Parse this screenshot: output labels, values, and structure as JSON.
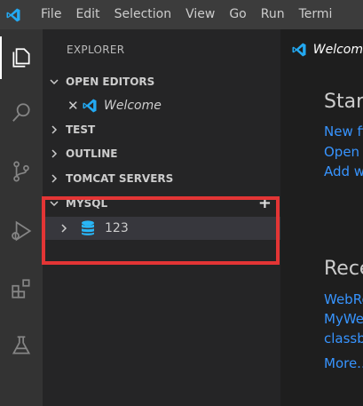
{
  "menubar": {
    "items": [
      "File",
      "Edit",
      "Selection",
      "View",
      "Go",
      "Run",
      "Termi"
    ]
  },
  "sidebar": {
    "title": "EXPLORER",
    "sections": {
      "open_editors": "OPEN EDITORS",
      "test": "TEST",
      "outline": "OUTLINE",
      "tomcat": "TOMCAT SERVERS",
      "mysql": "MYSQL"
    },
    "open_editor_label": "Welcome",
    "mysql_add": "+",
    "mysql_connection": "123"
  },
  "editor": {
    "tab_label": "Welcom",
    "start_heading": "Start",
    "start_links": [
      "New fi",
      "Open",
      "Add w"
    ],
    "recent_heading": "Rece",
    "recent_links": [
      "WebRe",
      "MyWe",
      "classb"
    ],
    "more_link": "More..."
  },
  "colors": {
    "accent": "#3794ff",
    "highlight_box": "#e33535",
    "vscode_blue": "#23a9f2"
  }
}
